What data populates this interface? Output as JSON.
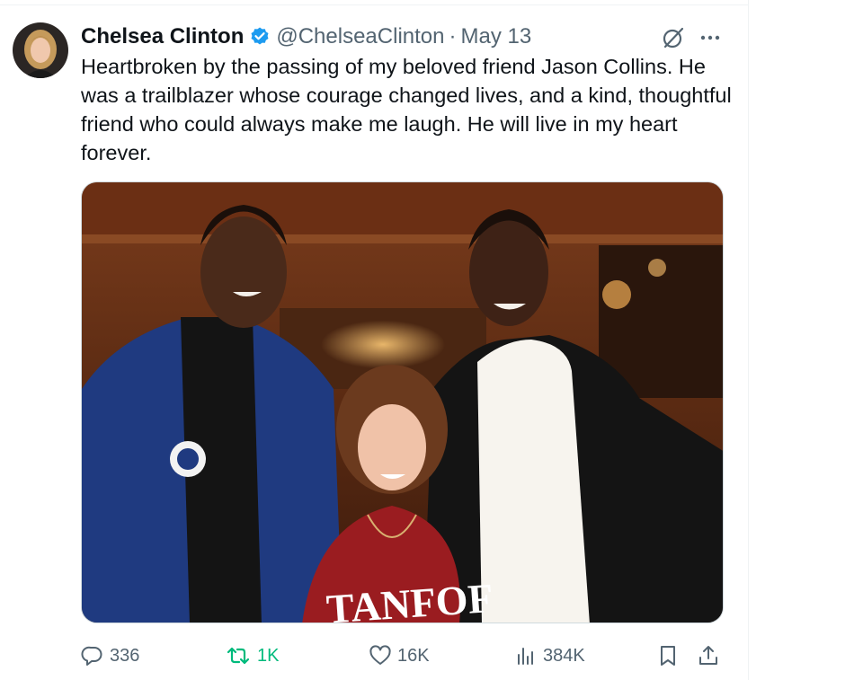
{
  "tweet": {
    "author": {
      "display_name": "Chelsea Clinton",
      "handle": "@ChelseaClinton",
      "verified": true
    },
    "separator": "·",
    "date": "May 13",
    "text": "Heartbroken by the passing of my beloved friend Jason Collins. He was a trailblazer whose courage changed lives, and a kind, thoughtful friend who could always make me laugh. He will live in my heart forever.",
    "photo": {
      "visible_print": "TANFOF"
    },
    "metrics": {
      "replies": "336",
      "reposts": "1K",
      "likes": "16K",
      "views": "384K"
    }
  },
  "icons": {
    "header": [
      "verified-badge-icon",
      "grok-icon",
      "more-icon"
    ],
    "actions": [
      "reply-icon",
      "repost-icon",
      "like-icon",
      "views-icon",
      "bookmark-icon",
      "share-icon"
    ]
  },
  "colors": {
    "primary_text": "#0f1419",
    "secondary_text": "#536471",
    "verified_blue": "#1d9bf0",
    "repost_green": "#00ba7c"
  }
}
